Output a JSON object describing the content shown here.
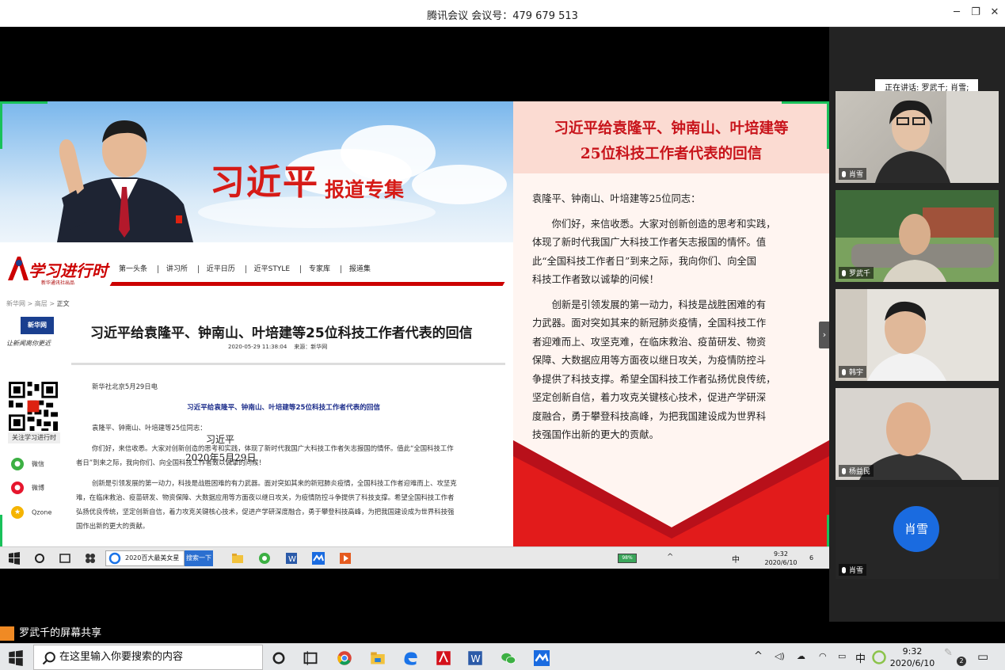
{
  "window": {
    "title": "腾讯会议 会议号：479 679 513"
  },
  "banner": {
    "title": "习近平",
    "subtitle": "报道专集"
  },
  "site": {
    "logo_text": "学习进行时",
    "logo_sub": "新华通讯社出品",
    "nav": [
      "第一头条",
      "讲习所",
      "近平日历",
      "近平STYLE",
      "专家库",
      "报道集"
    ]
  },
  "breadcrumb": {
    "items": [
      "新华网",
      "高层"
    ],
    "current": "正文"
  },
  "xinhua_logo": {
    "top": "新华网",
    "bottom": "让新闻离你更近"
  },
  "article": {
    "title": "习近平给袁隆平、钟南山、叶培建等25位科技工作者代表的回信",
    "meta": "2020-05-29 11:38:04    来源：新华网",
    "dateline": "新华社北京5月29日电",
    "subhead": "习近平给袁隆平、钟南山、叶培建等25位科技工作者代表的回信",
    "salutation": "袁隆平、钟南山、叶培建等25位同志：",
    "para1a": "你们好，来信收悉。大家对创新创造的思考和实践，体现了新时代我国广大科技工作者矢志报国的情怀。值此“全国科技工作",
    "para1b": "者日”到来之际，我向你们、向全国科技工作者致以诚挚的问候！",
    "para2a": "创新是引领发展的第一动力，科技是战胜困难的有力武器。面对突如其来的新冠肺炎疫情，全国科技工作者迎难而上、攻坚克",
    "para2b": "难，在临床救治、疫苗研发、物资保障、大数据应用等方面夜以继日攻关，为疫情防控斗争提供了科技支撑。希望全国科技工作者",
    "para2c": "弘扬优良传统，坚定创新自信，着力攻克关键核心技术，促进产学研深度融合，勇于攀登科技高峰，为把我国建设成为世界科技强",
    "para2d": "国作出新的更大的贡献。"
  },
  "share_panel": {
    "qr_label": "关注学习进行时",
    "items": [
      {
        "label": "微信",
        "color": "#3cb043",
        "icon": "wechat-icon"
      },
      {
        "label": "微博",
        "color": "#e6162d",
        "icon": "weibo-icon"
      },
      {
        "label": "Qzone",
        "color": "#f5b400",
        "icon": "qzone-icon"
      }
    ]
  },
  "letter": {
    "title_line1": "习近平给袁隆平、钟南山、叶培建等",
    "title_line2": "25位科技工作者代表的回信",
    "lines": [
      "袁隆平、钟南山、叶培建等25位同志：",
      "　　你们好，来信收悉。大家对创新创造的思考和实践，",
      "体现了新时代我国广大科技工作者矢志报国的情怀。值",
      "此“全国科技工作者日”到来之际，我向你们、向全国",
      "科技工作者致以诚挚的问候！",
      "　　创新是引领发展的第一动力，科技是战胜困难的有",
      "力武器。面对突如其来的新冠肺炎疫情，全国科技工作",
      "者迎难而上、攻坚克难，在临床救治、疫苗研发、物资",
      "保障、大数据应用等方面夜以继日攻关，为疫情防控斗",
      "争提供了科技支撑。希望全国科技工作者弘扬优良传统，",
      "坚定创新自信，着力攻克关键核心技术，促进产学研深",
      "度融合，勇于攀登科技高峰，为把我国建设成为世界科",
      "技强国作出新的更大的贡献。"
    ],
    "signature": "习近平",
    "date": "2020年5月29日"
  },
  "inner_taskbar": {
    "search_text": "2020百大最美女星",
    "search_button": "搜索一下",
    "battery": "98%",
    "time": "9:32",
    "date": "2020/6/10",
    "ime": "中",
    "badge": "6"
  },
  "participants": {
    "speaking": "正在讲话: 罗武千; 肖雪;",
    "tiles": [
      {
        "name": "肖雪"
      },
      {
        "name": "罗武千"
      },
      {
        "name": "韩宇"
      },
      {
        "name": "杨益民"
      },
      {
        "name": "肖雪",
        "avatar": "肖雪"
      }
    ]
  },
  "share_label": "罗武千的屏幕共享",
  "taskbar": {
    "search_placeholder": "在这里输入你要搜索的内容",
    "ime": "中",
    "time": "9:32",
    "date": "2020/6/10",
    "badge": "2"
  }
}
